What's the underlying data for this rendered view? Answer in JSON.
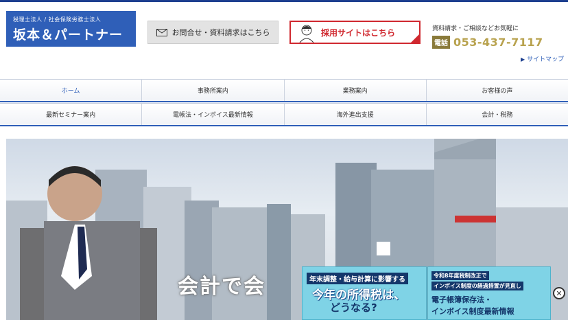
{
  "header": {
    "logo_sub": "税理士法人 / 社会保険労務士法人",
    "logo_main": "坂本＆パートナー",
    "contact_button": "お問合せ・資料請求はこちら",
    "recruit_button": "採用サイトはこちら",
    "inquiry_text": "資料請求・ご相談などお気軽に",
    "tel_tag": "電話",
    "tel_number": "053-437-7117",
    "sitemap": "サイトマップ"
  },
  "nav": {
    "row1": [
      "ホーム",
      "事務所案内",
      "業務案内",
      "お客様の声"
    ],
    "row2": [
      "最新セミナー案内",
      "電帳法・インボイス最新情報",
      "海外進出支援",
      "会計・税務"
    ]
  },
  "hero": {
    "text": "会計で会"
  },
  "banners": {
    "b1_line1": "年末調整・給与計算に影響する",
    "b1_line2": "今年の所得税は、",
    "b1_line3": "どうなる?",
    "b2_line1": "令和8年度税制改正で",
    "b2_line2": "インボイス制度の経過措置が見直し",
    "b2_line3": "電子帳簿保存法・",
    "b2_line4": "インボイス制度最新情報"
  },
  "colors": {
    "brand_blue": "#2f5fb8",
    "recruit_red": "#d0282f",
    "tel_gold": "#b8a24e",
    "banner_cyan": "#7fd3e6"
  }
}
